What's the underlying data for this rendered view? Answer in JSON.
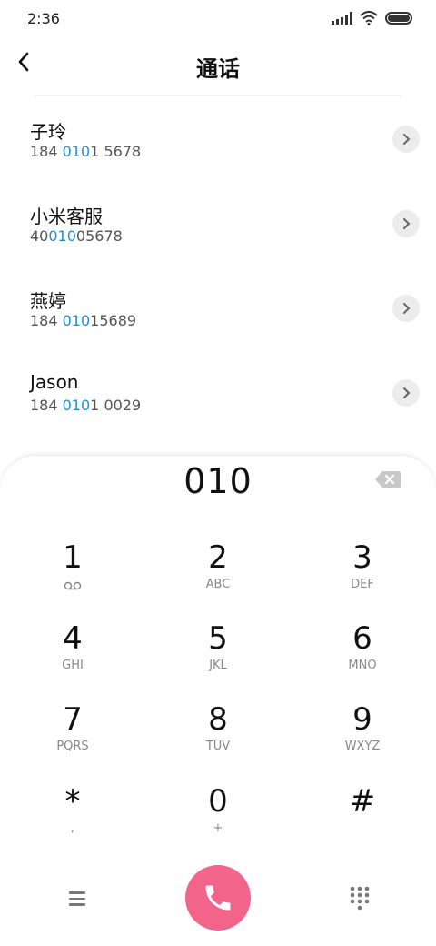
{
  "status_bar": {
    "time": "2:36",
    "icons": [
      "signal-icon",
      "wifi-icon",
      "battery-icon"
    ]
  },
  "header": {
    "back_icon": "back-arrow-icon",
    "title": "通话"
  },
  "contacts": [
    {
      "name": "子玲",
      "number_pre": "184 ",
      "number_match": "010",
      "number_post": "1 5678"
    },
    {
      "name": "小米客服",
      "number_pre": "40",
      "number_match": "010",
      "number_post": "05678"
    },
    {
      "name": "燕婷",
      "number_pre": "184 ",
      "number_match": "010",
      "number_post": "15689"
    },
    {
      "name": "Jason",
      "number_pre": "184 ",
      "number_match": "010",
      "number_post": "1 0029"
    }
  ],
  "dialer": {
    "dialed": "010",
    "keys": [
      {
        "digit": "1",
        "letters": ""
      },
      {
        "digit": "2",
        "letters": "ABC"
      },
      {
        "digit": "3",
        "letters": "DEF"
      },
      {
        "digit": "4",
        "letters": "GHI"
      },
      {
        "digit": "5",
        "letters": "JKL"
      },
      {
        "digit": "6",
        "letters": "MNO"
      },
      {
        "digit": "7",
        "letters": "PQRS"
      },
      {
        "digit": "8",
        "letters": "TUV"
      },
      {
        "digit": "9",
        "letters": "WXYZ"
      },
      {
        "digit": "*",
        "letters": ","
      },
      {
        "digit": "0",
        "letters": "+"
      },
      {
        "digit": "#",
        "letters": ""
      }
    ]
  },
  "colors": {
    "accent_match": "#1e90d6",
    "call_button": "#f3648a"
  }
}
